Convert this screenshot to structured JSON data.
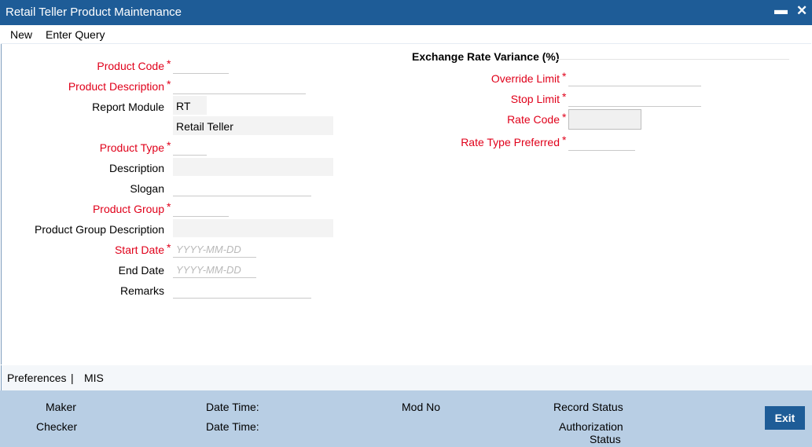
{
  "window": {
    "title": "Retail Teller Product Maintenance",
    "minimize_glyph": "▬",
    "close_glyph": "✕"
  },
  "menu": {
    "new": "New",
    "enter_query": "Enter Query"
  },
  "left_form": {
    "product_code": {
      "label": "Product Code",
      "value": ""
    },
    "product_description": {
      "label": "Product Description",
      "value": ""
    },
    "report_module": {
      "label": "Report Module",
      "value": "RT",
      "desc": "Retail Teller"
    },
    "product_type": {
      "label": "Product Type",
      "value": ""
    },
    "description": {
      "label": "Description",
      "value": ""
    },
    "slogan": {
      "label": "Slogan",
      "value": ""
    },
    "product_group": {
      "label": "Product Group",
      "value": ""
    },
    "product_group_description": {
      "label": "Product Group Description",
      "value": ""
    },
    "start_date": {
      "label": "Start Date",
      "placeholder": "YYYY-MM-DD"
    },
    "end_date": {
      "label": "End Date",
      "placeholder": "YYYY-MM-DD"
    },
    "remarks": {
      "label": "Remarks",
      "value": ""
    }
  },
  "right_form": {
    "section_title": "Exchange Rate Variance (%)",
    "override_limit": {
      "label": "Override Limit",
      "value": ""
    },
    "stop_limit": {
      "label": "Stop Limit",
      "value": ""
    },
    "rate_code": {
      "label": "Rate Code",
      "value": ""
    },
    "rate_type_preferred": {
      "label": "Rate Type Preferred",
      "value": ""
    }
  },
  "required_mark": "*",
  "tabs": {
    "preferences": "Preferences",
    "separator": "|",
    "mis": "MIS"
  },
  "footer": {
    "maker": "Maker",
    "checker": "Checker",
    "date_time_1": "Date Time:",
    "date_time_2": "Date Time:",
    "mod_no": "Mod No",
    "record_status": "Record Status",
    "authorization_line1": "Authorization",
    "authorization_line2": "Status",
    "exit": "Exit"
  },
  "colors": {
    "titlebar": "#1e5c97",
    "required": "#e0001a",
    "footer": "#b8cee4"
  }
}
